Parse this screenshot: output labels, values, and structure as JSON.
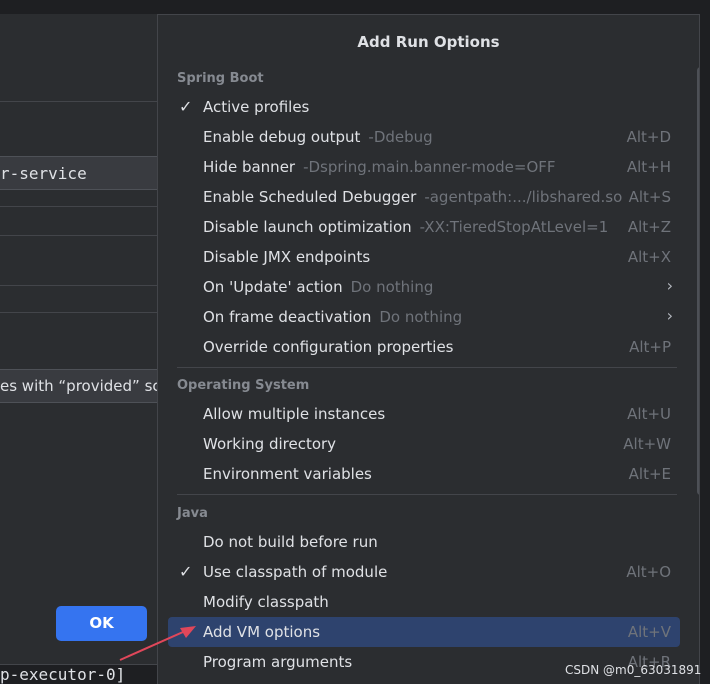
{
  "background": {
    "field_value": "r-service",
    "checkbox_label": "es with “provided” sco",
    "ok_label": "OK",
    "console_text": "p-executor-0]"
  },
  "popup": {
    "title": "Add Run Options",
    "sections": [
      {
        "header": "Spring Boot",
        "items": [
          {
            "label": "Active profiles",
            "checked": true
          },
          {
            "label": "Enable debug output",
            "hint": "-Ddebug",
            "shortcut": "Alt+D"
          },
          {
            "label": "Hide banner",
            "hint": "-Dspring.main.banner-mode=OFF",
            "shortcut": "Alt+H"
          },
          {
            "label": "Enable Scheduled Debugger",
            "hint": "-agentpath:.../libshared.so",
            "shortcut": "Alt+S"
          },
          {
            "label": "Disable launch optimization",
            "hint": "-XX:TieredStopAtLevel=1",
            "shortcut": "Alt+Z"
          },
          {
            "label": "Disable JMX endpoints",
            "shortcut": "Alt+X"
          },
          {
            "label": "On 'Update' action",
            "hint": "Do nothing",
            "submenu": true
          },
          {
            "label": "On frame deactivation",
            "hint": "Do nothing",
            "submenu": true
          },
          {
            "label": "Override configuration properties",
            "shortcut": "Alt+P"
          }
        ]
      },
      {
        "header": "Operating System",
        "items": [
          {
            "label": "Allow multiple instances",
            "shortcut": "Alt+U"
          },
          {
            "label": "Working directory",
            "shortcut": "Alt+W"
          },
          {
            "label": "Environment variables",
            "shortcut": "Alt+E"
          }
        ]
      },
      {
        "header": "Java",
        "items": [
          {
            "label": "Do not build before run"
          },
          {
            "label": "Use classpath of module",
            "checked": true,
            "shortcut": "Alt+O"
          },
          {
            "label": "Modify classpath"
          },
          {
            "label": "Add VM options",
            "shortcut": "Alt+V",
            "selected": true
          },
          {
            "label": "Program arguments",
            "shortcut": "Alt+R"
          }
        ]
      }
    ],
    "check_glyph": "✓",
    "chevron_glyph": "›"
  },
  "watermark": "CSDN @m0_63031891",
  "colors": {
    "accent": "#3574f0",
    "selection": "#2e436e",
    "arrow": "#e0475a"
  }
}
